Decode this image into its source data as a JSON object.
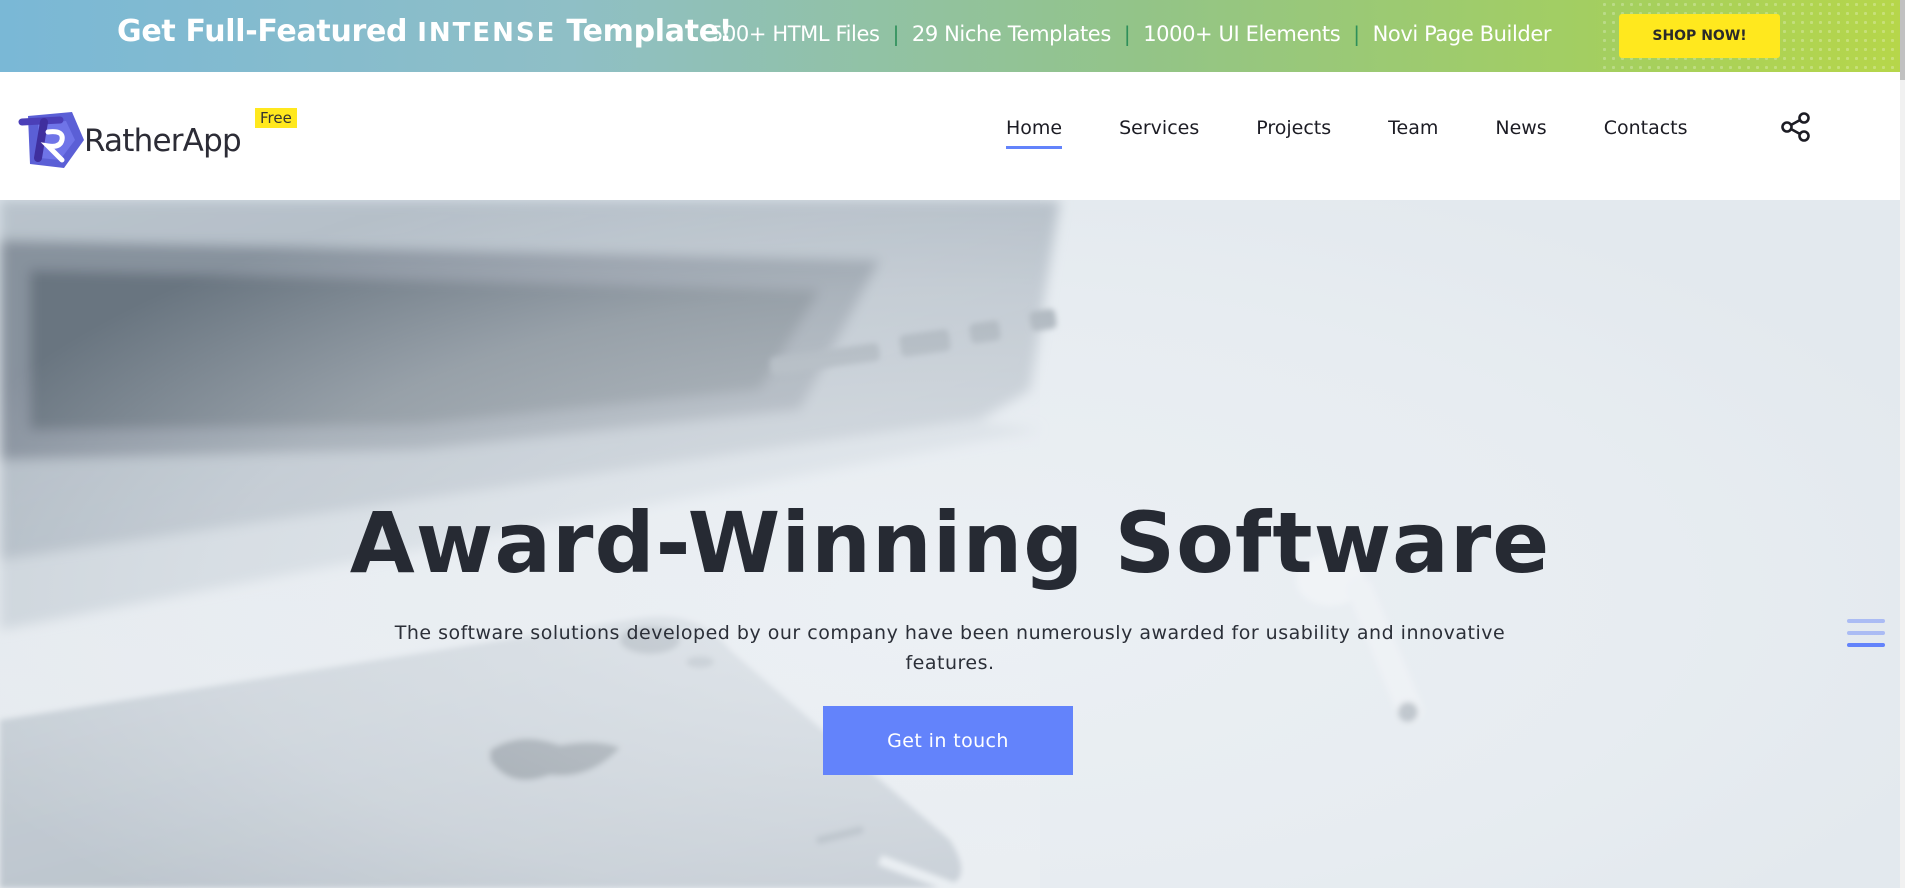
{
  "promo": {
    "headline_prefix": "Get Full-Featured",
    "headline_brand": "INTENSE",
    "headline_suffix": "Template!",
    "features": [
      "500+ HTML Files",
      "29 Niche Templates",
      "1000+ UI Elements",
      "Novi Page Builder"
    ],
    "separator": "|",
    "shop_label": "SHOP NOW!"
  },
  "header": {
    "logo_text": "RatherApp",
    "badge": "Free",
    "nav": [
      {
        "label": "Home",
        "active": true
      },
      {
        "label": "Services",
        "active": false
      },
      {
        "label": "Projects",
        "active": false
      },
      {
        "label": "Team",
        "active": false
      },
      {
        "label": "News",
        "active": false
      },
      {
        "label": "Contacts",
        "active": false
      }
    ],
    "share_icon": "share-icon"
  },
  "hero": {
    "title": "Award-Winning Software",
    "subtitle": "The software solutions developed by our company have been numerously awarded for usability and innovative features.",
    "cta_label": "Get in touch",
    "side_icon": "menu-lines-icon"
  },
  "colors": {
    "accent": "#6383fb",
    "shop_button": "#ffe81e",
    "badge": "#ffe81e",
    "heading": "#262a33"
  }
}
